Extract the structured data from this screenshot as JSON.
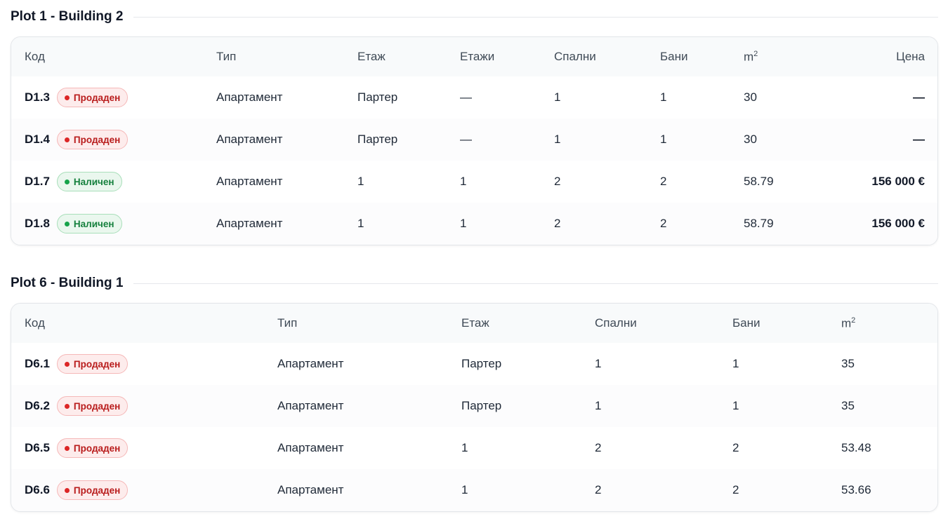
{
  "sections": [
    {
      "title": "Plot 1 - Building 2",
      "headers": {
        "code": "Код",
        "type": "Тип",
        "floor": "Етаж",
        "floors": "Етажи",
        "bedrooms": "Спални",
        "bathrooms": "Бани",
        "area": "m",
        "area_sup": "2",
        "price": "Цена"
      },
      "rows": [
        {
          "code": "D1.3",
          "status": "Продаден",
          "status_kind": "sold",
          "type": "Апартамент",
          "floor": "Партер",
          "floors": "—",
          "bedrooms": "1",
          "bathrooms": "1",
          "area": "30",
          "price": "—"
        },
        {
          "code": "D1.4",
          "status": "Продаден",
          "status_kind": "sold",
          "type": "Апартамент",
          "floor": "Партер",
          "floors": "—",
          "bedrooms": "1",
          "bathrooms": "1",
          "area": "30",
          "price": "—"
        },
        {
          "code": "D1.7",
          "status": "Наличен",
          "status_kind": "available",
          "type": "Апартамент",
          "floor": "1",
          "floors": "1",
          "bedrooms": "2",
          "bathrooms": "2",
          "area": "58.79",
          "price": "156 000 €"
        },
        {
          "code": "D1.8",
          "status": "Наличен",
          "status_kind": "available",
          "type": "Апартамент",
          "floor": "1",
          "floors": "1",
          "bedrooms": "2",
          "bathrooms": "2",
          "area": "58.79",
          "price": "156 000 €"
        }
      ]
    },
    {
      "title": "Plot 6 - Building 1",
      "headers": {
        "code": "Код",
        "type": "Тип",
        "floor": "Етаж",
        "bedrooms": "Спални",
        "bathrooms": "Бани",
        "area": "m",
        "area_sup": "2"
      },
      "rows": [
        {
          "code": "D6.1",
          "status": "Продаден",
          "status_kind": "sold",
          "type": "Апартамент",
          "floor": "Партер",
          "bedrooms": "1",
          "bathrooms": "1",
          "area": "35"
        },
        {
          "code": "D6.2",
          "status": "Продаден",
          "status_kind": "sold",
          "type": "Апартамент",
          "floor": "Партер",
          "bedrooms": "1",
          "bathrooms": "1",
          "area": "35"
        },
        {
          "code": "D6.5",
          "status": "Продаден",
          "status_kind": "sold",
          "type": "Апартамент",
          "floor": "1",
          "bedrooms": "2",
          "bathrooms": "2",
          "area": "53.48"
        },
        {
          "code": "D6.6",
          "status": "Продаден",
          "status_kind": "sold",
          "type": "Апартамент",
          "floor": "1",
          "bedrooms": "2",
          "bathrooms": "2",
          "area": "53.66"
        }
      ]
    }
  ],
  "colors": {
    "sold_text": "#b91c1c",
    "sold_dot": "#dc2626",
    "sold_bg": "#fdecec",
    "available_text": "#15803d",
    "available_dot": "#16a34a",
    "available_bg": "#eaf7ee"
  }
}
